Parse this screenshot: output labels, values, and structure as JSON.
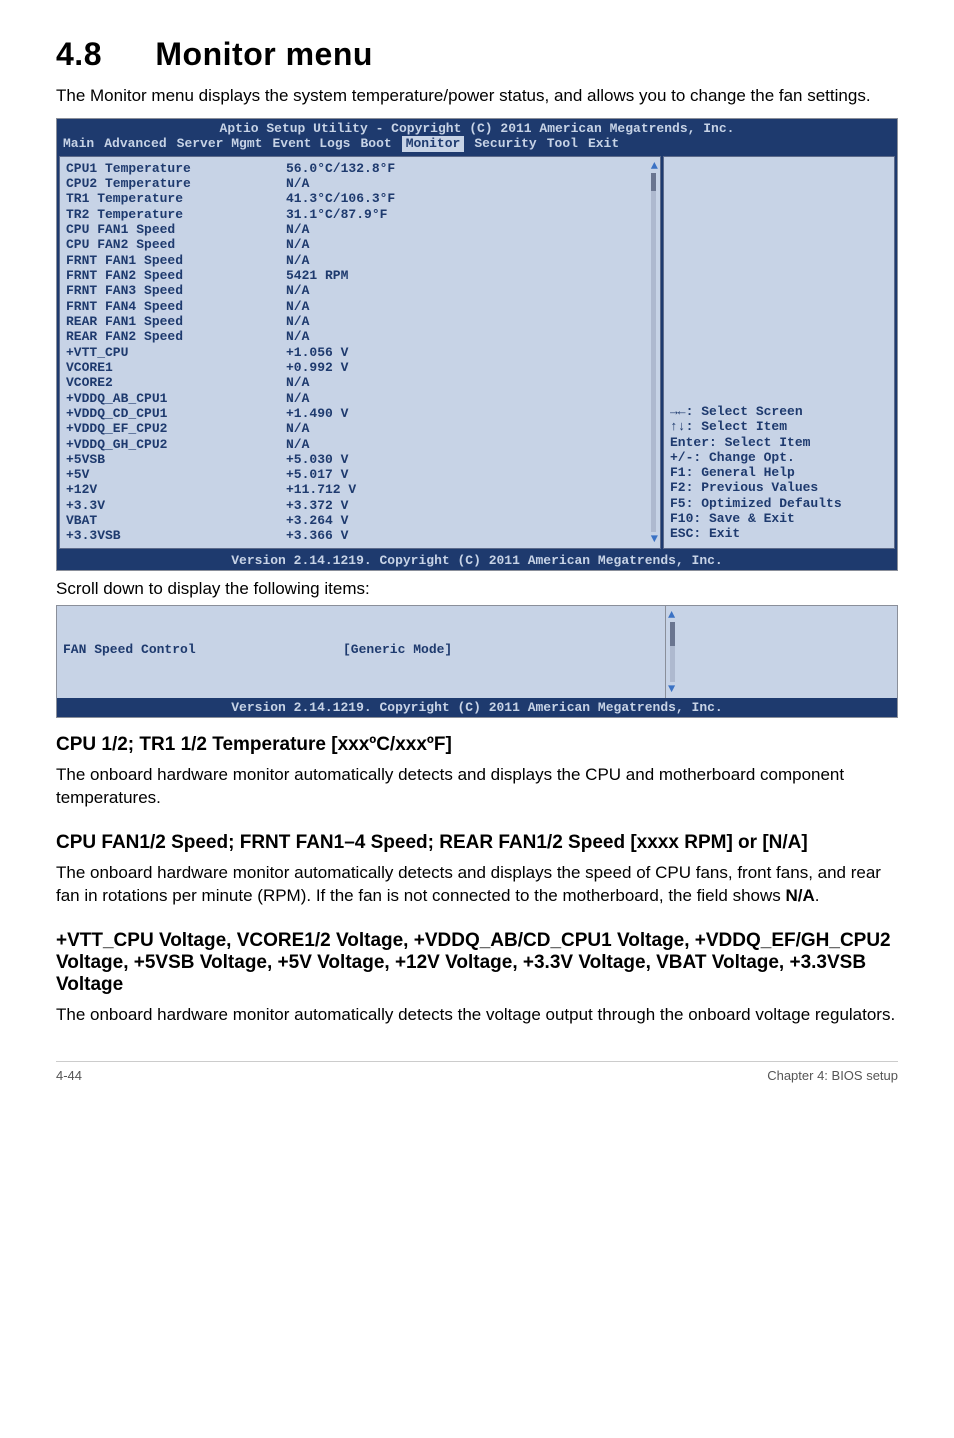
{
  "heading": {
    "number": "4.8",
    "title": "Monitor menu"
  },
  "intro": "The Monitor menu displays the system temperature/power status, and allows you to change the fan settings.",
  "bios": {
    "topline": "Aptio Setup Utility - Copyright (C) 2011 American Megatrends, Inc.",
    "tabs": [
      "Main",
      "Advanced",
      "Server Mgmt",
      "Event Logs",
      "Boot",
      "Monitor",
      "Security",
      "Tool",
      "Exit"
    ],
    "active_tab": "Monitor",
    "rows": [
      {
        "label": "CPU1 Temperature",
        "value": "56.0°C/132.8°F"
      },
      {
        "label": "CPU2 Temperature",
        "value": "N/A"
      },
      {
        "label": "TR1 Temperature",
        "value": "41.3°C/106.3°F"
      },
      {
        "label": "TR2 Temperature",
        "value": "31.1°C/87.9°F"
      },
      {
        "label": "CPU FAN1 Speed",
        "value": "N/A"
      },
      {
        "label": "CPU FAN2 Speed",
        "value": "N/A"
      },
      {
        "label": "FRNT FAN1 Speed",
        "value": "N/A"
      },
      {
        "label": "FRNT FAN2 Speed",
        "value": "5421 RPM"
      },
      {
        "label": "FRNT FAN3 Speed",
        "value": "N/A"
      },
      {
        "label": "FRNT FAN4 Speed",
        "value": "N/A"
      },
      {
        "label": "REAR FAN1 Speed",
        "value": "N/A"
      },
      {
        "label": "REAR FAN2 Speed",
        "value": "N/A"
      },
      {
        "label": "+VTT_CPU",
        "value": "+1.056 V"
      },
      {
        "label": "VCORE1",
        "value": "+0.992 V"
      },
      {
        "label": "VCORE2",
        "value": "N/A"
      },
      {
        "label": "+VDDQ_AB_CPU1",
        "value": "N/A"
      },
      {
        "label": "+VDDQ_CD_CPU1",
        "value": "+1.490 V"
      },
      {
        "label": "+VDDQ_EF_CPU2",
        "value": "N/A"
      },
      {
        "label": "+VDDQ_GH_CPU2",
        "value": "N/A"
      },
      {
        "label": "+5VSB",
        "value": "+5.030 V"
      },
      {
        "label": "+5V",
        "value": "+5.017 V"
      },
      {
        "label": "+12V",
        "value": "+11.712 V"
      },
      {
        "label": "+3.3V",
        "value": "+3.372 V"
      },
      {
        "label": "VBAT",
        "value": "+3.264 V"
      },
      {
        "label": "+3.3VSB",
        "value": "+3.366 V"
      }
    ],
    "nav": [
      "→←: Select Screen",
      "↑↓:  Select Item",
      "Enter: Select Item",
      "+/-: Change Opt.",
      "F1: General Help",
      "F2: Previous Values",
      "F5: Optimized Defaults",
      "F10: Save & Exit",
      "ESC: Exit"
    ],
    "footer": "Version 2.14.1219. Copyright (C) 2011 American Megatrends, Inc."
  },
  "scroll_note": "Scroll down to display the following items:",
  "bios2": {
    "row": {
      "label": "FAN Speed Control",
      "value": "[Generic Mode]"
    },
    "footer": "Version 2.14.1219. Copyright (C) 2011 American Megatrends, Inc."
  },
  "sections": [
    {
      "heading": "CPU 1/2; TR1 1/2 Temperature [xxxºC/xxxºF]",
      "body_pre": "The onboard hardware monitor automatically detects and displays the CPU and motherboard component ",
      "body_em": "temperatures",
      "body_post": "."
    },
    {
      "heading": "CPU FAN1/2 Speed; FRNT FAN1–4 Speed; REAR FAN1/2 Speed [xxxx RPM] or [N/A]",
      "body": "The onboard hardware monitor automatically detects and displays the speed of CPU fans, front fans, and rear fan in rotations per minute (RPM). If the fan is not connected to the motherboard, the field shows ",
      "body_bold": "N/A",
      "body_post": "."
    },
    {
      "heading": "+VTT_CPU Voltage, VCORE1/2 Voltage, +VDDQ_AB/CD_CPU1 Voltage,  +VDDQ_EF/GH_CPU2 Voltage, +5VSB Voltage, +5V Voltage, +12V Voltage, +3.3V Voltage, VBAT Voltage, +3.3VSB Voltage",
      "body": "The onboard hardware monitor automatically detects the voltage output through the onboard voltage regulators."
    }
  ],
  "page_footer": {
    "left": "4-44",
    "right": "Chapter 4: BIOS setup"
  }
}
